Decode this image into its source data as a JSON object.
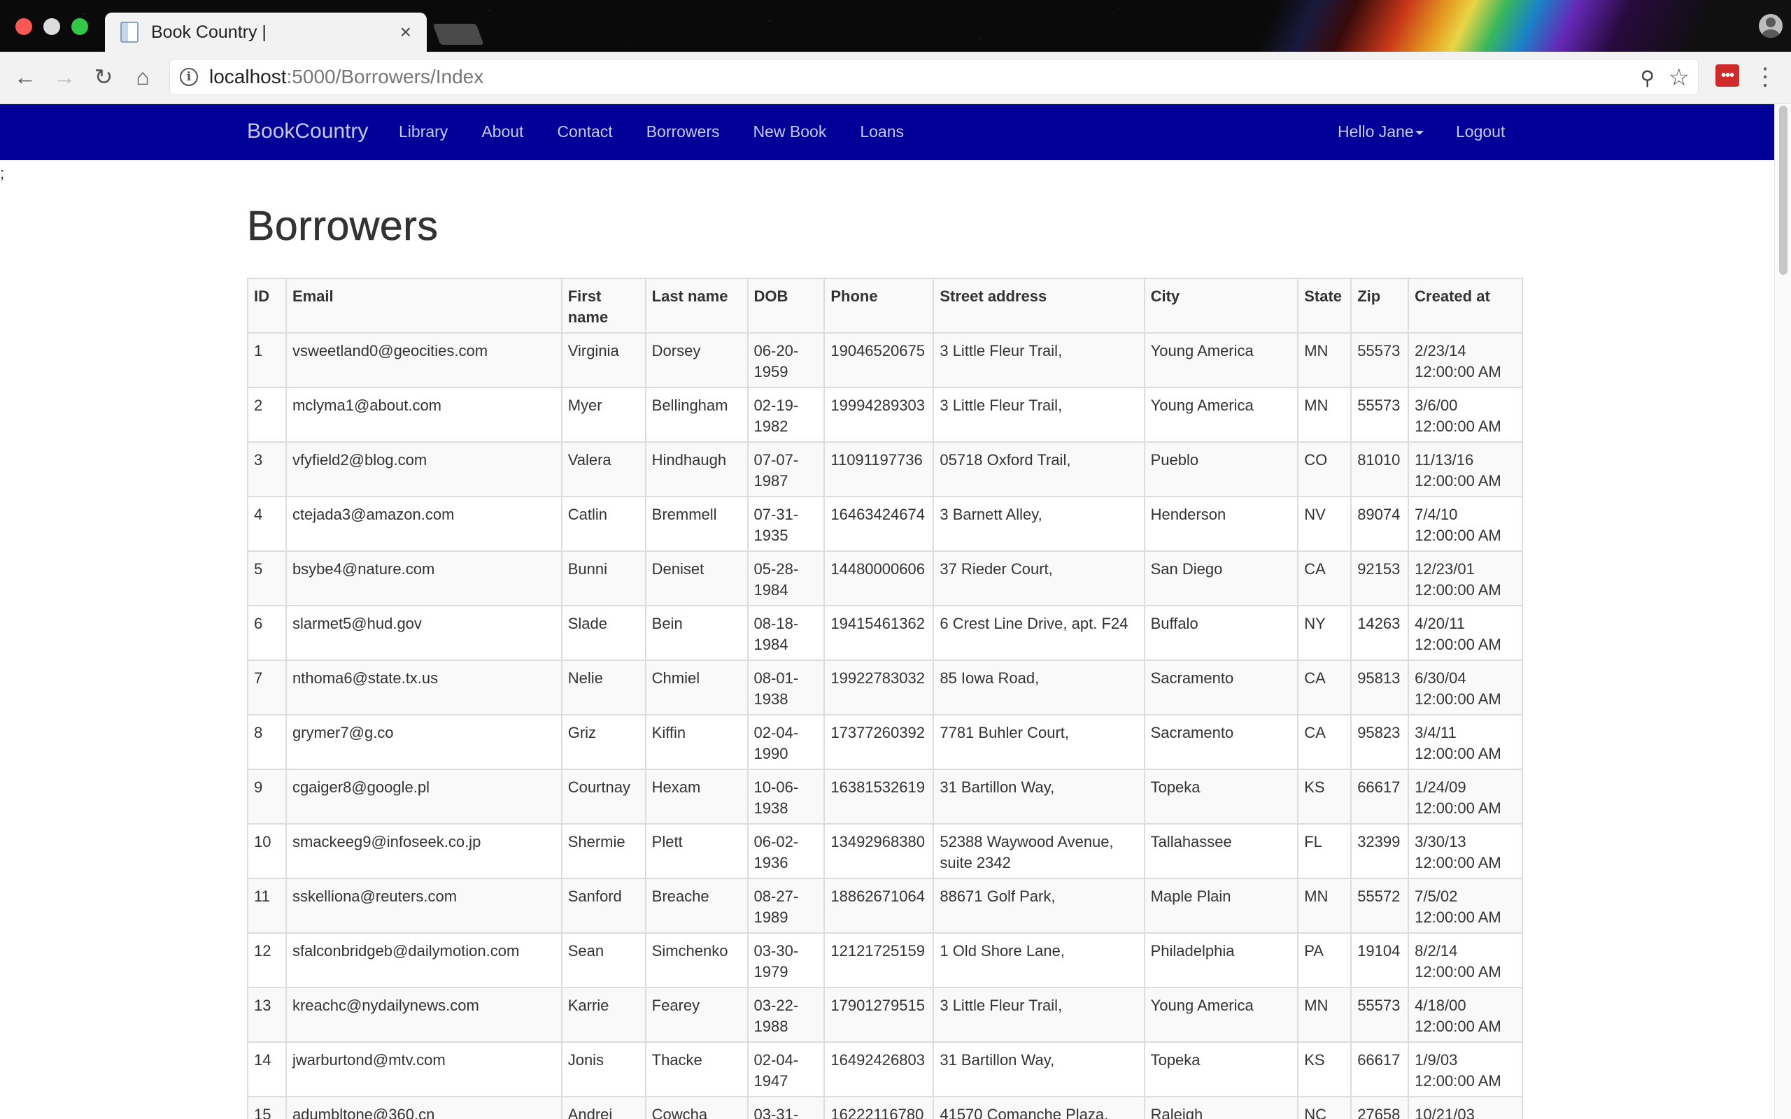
{
  "browser": {
    "tab_title": "Book Country |",
    "url_host": "localhost",
    "url_rest": ":5000/Borrowers/Index"
  },
  "nav": {
    "brand": "BookCountry",
    "links": [
      "Library",
      "About",
      "Contact",
      "Borrowers",
      "New Book",
      "Loans"
    ],
    "user_greeting": "Hello Jane",
    "logout": "Logout"
  },
  "stray_text": ";",
  "page": {
    "title": "Borrowers"
  },
  "table": {
    "headers": [
      "ID",
      "Email",
      "First name",
      "Last name",
      "DOB",
      "Phone",
      "Street address",
      "City",
      "State",
      "Zip",
      "Created at"
    ],
    "rows": [
      [
        "1",
        "vsweetland0@geocities.com",
        "Virginia",
        "Dorsey",
        "06-20-1959",
        "19046520675",
        "3 Little Fleur Trail,",
        "Young America",
        "MN",
        "55573",
        "2/23/14 12:00:00 AM"
      ],
      [
        "2",
        "mclyma1@about.com",
        "Myer",
        "Bellingham",
        "02-19-1982",
        "19994289303",
        "3 Little Fleur Trail,",
        "Young America",
        "MN",
        "55573",
        "3/6/00 12:00:00 AM"
      ],
      [
        "3",
        "vfyfield2@blog.com",
        "Valera",
        "Hindhaugh",
        "07-07-1987",
        "11091197736",
        "05718 Oxford Trail,",
        "Pueblo",
        "CO",
        "81010",
        "11/13/16 12:00:00 AM"
      ],
      [
        "4",
        "ctejada3@amazon.com",
        "Catlin",
        "Bremmell",
        "07-31-1935",
        "16463424674",
        "3 Barnett Alley,",
        "Henderson",
        "NV",
        "89074",
        "7/4/10 12:00:00 AM"
      ],
      [
        "5",
        "bsybe4@nature.com",
        "Bunni",
        "Deniset",
        "05-28-1984",
        "14480000606",
        "37 Rieder Court,",
        "San Diego",
        "CA",
        "92153",
        "12/23/01 12:00:00 AM"
      ],
      [
        "6",
        "slarmet5@hud.gov",
        "Slade",
        "Bein",
        "08-18-1984",
        "19415461362",
        "6 Crest Line Drive, apt. F24",
        "Buffalo",
        "NY",
        "14263",
        "4/20/11 12:00:00 AM"
      ],
      [
        "7",
        "nthoma6@state.tx.us",
        "Nelie",
        "Chmiel",
        "08-01-1938",
        "19922783032",
        "85 Iowa Road,",
        "Sacramento",
        "CA",
        "95813",
        "6/30/04 12:00:00 AM"
      ],
      [
        "8",
        "grymer7@g.co",
        "Griz",
        "Kiffin",
        "02-04-1990",
        "17377260392",
        "7781 Buhler Court,",
        "Sacramento",
        "CA",
        "95823",
        "3/4/11 12:00:00 AM"
      ],
      [
        "9",
        "cgaiger8@google.pl",
        "Courtnay",
        "Hexam",
        "10-06-1938",
        "16381532619",
        "31 Bartillon Way,",
        "Topeka",
        "KS",
        "66617",
        "1/24/09 12:00:00 AM"
      ],
      [
        "10",
        "smackeeg9@infoseek.co.jp",
        "Shermie",
        "Plett",
        "06-02-1936",
        "13492968380",
        "52388 Waywood Avenue, suite 2342",
        "Tallahassee",
        "FL",
        "32399",
        "3/30/13 12:00:00 AM"
      ],
      [
        "11",
        "sskelliona@reuters.com",
        "Sanford",
        "Breache",
        "08-27-1989",
        "18862671064",
        "88671 Golf Park,",
        "Maple Plain",
        "MN",
        "55572",
        "7/5/02 12:00:00 AM"
      ],
      [
        "12",
        "sfalconbridgeb@dailymotion.com",
        "Sean",
        "Simchenko",
        "03-30-1979",
        "12121725159",
        "1 Old Shore Lane,",
        "Philadelphia",
        "PA",
        "19104",
        "8/2/14 12:00:00 AM"
      ],
      [
        "13",
        "kreachc@nydailynews.com",
        "Karrie",
        "Fearey",
        "03-22-1988",
        "17901279515",
        "3 Little Fleur Trail,",
        "Young America",
        "MN",
        "55573",
        "4/18/00 12:00:00 AM"
      ],
      [
        "14",
        "jwarburtond@mtv.com",
        "Jonis",
        "Thacke",
        "02-04-1947",
        "16492426803",
        "31 Bartillon Way,",
        "Topeka",
        "KS",
        "66617",
        "1/9/03 12:00:00 AM"
      ],
      [
        "15",
        "adumbltone@360.cn",
        "Andrei",
        "Cowcha",
        "03-31-",
        "16222116780",
        "41570 Comanche Plaza,",
        "Raleigh",
        "NC",
        "27658",
        "10/21/03"
      ]
    ]
  },
  "colors": {
    "navbar": "#000099",
    "nav_text": "#c9c9ef"
  }
}
